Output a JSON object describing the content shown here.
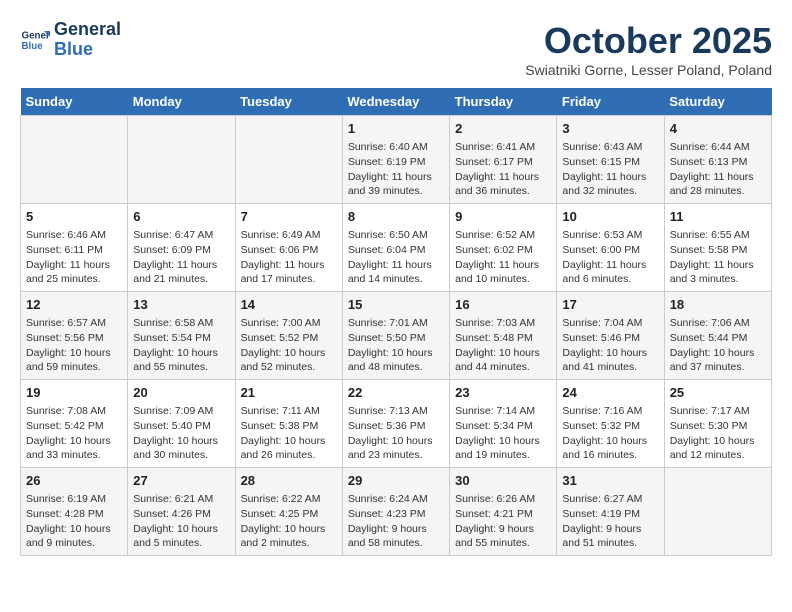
{
  "header": {
    "logo_line1": "General",
    "logo_line2": "Blue",
    "month": "October 2025",
    "location": "Swiatniki Gorne, Lesser Poland, Poland"
  },
  "weekdays": [
    "Sunday",
    "Monday",
    "Tuesday",
    "Wednesday",
    "Thursday",
    "Friday",
    "Saturday"
  ],
  "weeks": [
    [
      {
        "day": "",
        "content": ""
      },
      {
        "day": "",
        "content": ""
      },
      {
        "day": "",
        "content": ""
      },
      {
        "day": "1",
        "content": "Sunrise: 6:40 AM\nSunset: 6:19 PM\nDaylight: 11 hours and 39 minutes."
      },
      {
        "day": "2",
        "content": "Sunrise: 6:41 AM\nSunset: 6:17 PM\nDaylight: 11 hours and 36 minutes."
      },
      {
        "day": "3",
        "content": "Sunrise: 6:43 AM\nSunset: 6:15 PM\nDaylight: 11 hours and 32 minutes."
      },
      {
        "day": "4",
        "content": "Sunrise: 6:44 AM\nSunset: 6:13 PM\nDaylight: 11 hours and 28 minutes."
      }
    ],
    [
      {
        "day": "5",
        "content": "Sunrise: 6:46 AM\nSunset: 6:11 PM\nDaylight: 11 hours and 25 minutes."
      },
      {
        "day": "6",
        "content": "Sunrise: 6:47 AM\nSunset: 6:09 PM\nDaylight: 11 hours and 21 minutes."
      },
      {
        "day": "7",
        "content": "Sunrise: 6:49 AM\nSunset: 6:06 PM\nDaylight: 11 hours and 17 minutes."
      },
      {
        "day": "8",
        "content": "Sunrise: 6:50 AM\nSunset: 6:04 PM\nDaylight: 11 hours and 14 minutes."
      },
      {
        "day": "9",
        "content": "Sunrise: 6:52 AM\nSunset: 6:02 PM\nDaylight: 11 hours and 10 minutes."
      },
      {
        "day": "10",
        "content": "Sunrise: 6:53 AM\nSunset: 6:00 PM\nDaylight: 11 hours and 6 minutes."
      },
      {
        "day": "11",
        "content": "Sunrise: 6:55 AM\nSunset: 5:58 PM\nDaylight: 11 hours and 3 minutes."
      }
    ],
    [
      {
        "day": "12",
        "content": "Sunrise: 6:57 AM\nSunset: 5:56 PM\nDaylight: 10 hours and 59 minutes."
      },
      {
        "day": "13",
        "content": "Sunrise: 6:58 AM\nSunset: 5:54 PM\nDaylight: 10 hours and 55 minutes."
      },
      {
        "day": "14",
        "content": "Sunrise: 7:00 AM\nSunset: 5:52 PM\nDaylight: 10 hours and 52 minutes."
      },
      {
        "day": "15",
        "content": "Sunrise: 7:01 AM\nSunset: 5:50 PM\nDaylight: 10 hours and 48 minutes."
      },
      {
        "day": "16",
        "content": "Sunrise: 7:03 AM\nSunset: 5:48 PM\nDaylight: 10 hours and 44 minutes."
      },
      {
        "day": "17",
        "content": "Sunrise: 7:04 AM\nSunset: 5:46 PM\nDaylight: 10 hours and 41 minutes."
      },
      {
        "day": "18",
        "content": "Sunrise: 7:06 AM\nSunset: 5:44 PM\nDaylight: 10 hours and 37 minutes."
      }
    ],
    [
      {
        "day": "19",
        "content": "Sunrise: 7:08 AM\nSunset: 5:42 PM\nDaylight: 10 hours and 33 minutes."
      },
      {
        "day": "20",
        "content": "Sunrise: 7:09 AM\nSunset: 5:40 PM\nDaylight: 10 hours and 30 minutes."
      },
      {
        "day": "21",
        "content": "Sunrise: 7:11 AM\nSunset: 5:38 PM\nDaylight: 10 hours and 26 minutes."
      },
      {
        "day": "22",
        "content": "Sunrise: 7:13 AM\nSunset: 5:36 PM\nDaylight: 10 hours and 23 minutes."
      },
      {
        "day": "23",
        "content": "Sunrise: 7:14 AM\nSunset: 5:34 PM\nDaylight: 10 hours and 19 minutes."
      },
      {
        "day": "24",
        "content": "Sunrise: 7:16 AM\nSunset: 5:32 PM\nDaylight: 10 hours and 16 minutes."
      },
      {
        "day": "25",
        "content": "Sunrise: 7:17 AM\nSunset: 5:30 PM\nDaylight: 10 hours and 12 minutes."
      }
    ],
    [
      {
        "day": "26",
        "content": "Sunrise: 6:19 AM\nSunset: 4:28 PM\nDaylight: 10 hours and 9 minutes."
      },
      {
        "day": "27",
        "content": "Sunrise: 6:21 AM\nSunset: 4:26 PM\nDaylight: 10 hours and 5 minutes."
      },
      {
        "day": "28",
        "content": "Sunrise: 6:22 AM\nSunset: 4:25 PM\nDaylight: 10 hours and 2 minutes."
      },
      {
        "day": "29",
        "content": "Sunrise: 6:24 AM\nSunset: 4:23 PM\nDaylight: 9 hours and 58 minutes."
      },
      {
        "day": "30",
        "content": "Sunrise: 6:26 AM\nSunset: 4:21 PM\nDaylight: 9 hours and 55 minutes."
      },
      {
        "day": "31",
        "content": "Sunrise: 6:27 AM\nSunset: 4:19 PM\nDaylight: 9 hours and 51 minutes."
      },
      {
        "day": "",
        "content": ""
      }
    ]
  ]
}
